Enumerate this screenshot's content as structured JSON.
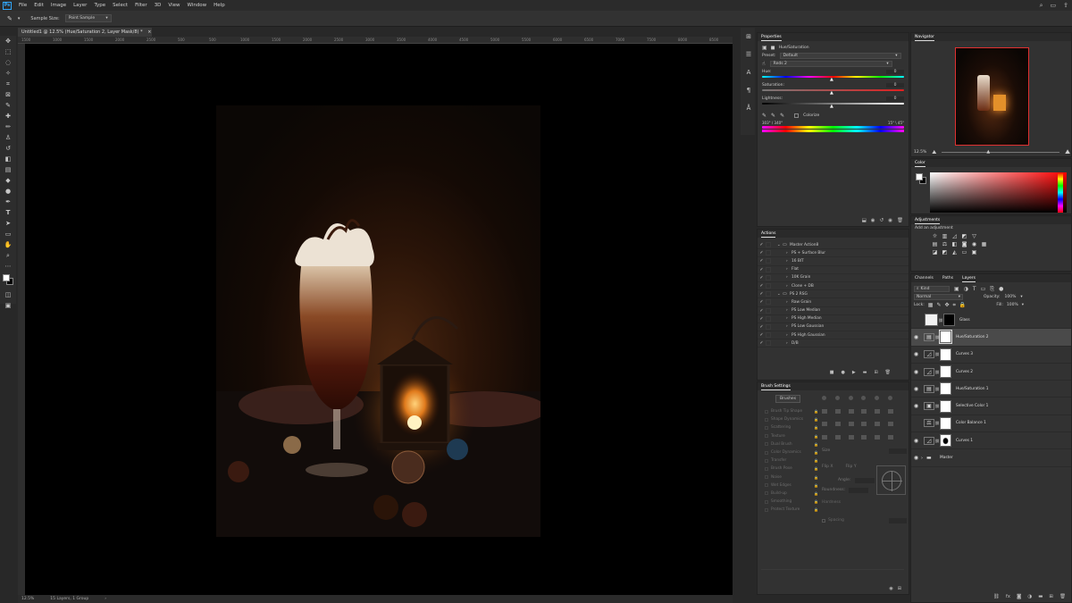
{
  "menubar": {
    "logo": "Ps",
    "items": [
      "File",
      "Edit",
      "Image",
      "Layer",
      "Type",
      "Select",
      "Filter",
      "3D",
      "View",
      "Window",
      "Help"
    ]
  },
  "options": {
    "sample_size_label": "Sample Size:",
    "sample_size_value": "Point Sample"
  },
  "document": {
    "tab_title": "Untitled1 @ 12.5% (Hue/Saturation 2, Layer Mask/8) *",
    "zoom": "12.5%",
    "status": "15 Layers, 1 Group"
  },
  "ruler": [
    "1500",
    "1000",
    "1500",
    "2000",
    "2500",
    "500",
    "500",
    "1000",
    "1500",
    "2000",
    "2500",
    "3000",
    "3500",
    "4000",
    "4500",
    "5000",
    "5500",
    "6000",
    "6500",
    "7000",
    "7500",
    "8000",
    "8500"
  ],
  "properties": {
    "title": "Properties",
    "adjustment": "Hue/Saturation",
    "preset_label": "Preset:",
    "preset_value": "Default",
    "channel_value": "Reds 2",
    "hue_label": "Hue:",
    "hue_value": "0",
    "saturation_label": "Saturation:",
    "saturation_value": "0",
    "lightness_label": "Lightness:",
    "lightness_value": "0",
    "colorize_label": "Colorize",
    "range_left": "303° / 340°",
    "range_right": "15° \\ 45°"
  },
  "navigator": {
    "title": "Navigator",
    "zoom": "12.5%"
  },
  "color": {
    "title": "Color"
  },
  "adjustments": {
    "title": "Adjustments",
    "add_label": "Add an adjustment"
  },
  "actions": {
    "title": "Actions",
    "rows": [
      {
        "label": "Master Action8",
        "level": 0,
        "expanded": true,
        "folder": true
      },
      {
        "label": "PS + Surface Blur",
        "level": 1
      },
      {
        "label": "16 BIT",
        "level": 1
      },
      {
        "label": "Flat",
        "level": 1
      },
      {
        "label": "10K Grain",
        "level": 1
      },
      {
        "label": "Clone + DB",
        "level": 1
      },
      {
        "label": "PS 2 RSG",
        "level": 0,
        "expanded": true,
        "folder": true
      },
      {
        "label": "Raw Grain",
        "level": 1
      },
      {
        "label": "PS Low Median",
        "level": 1
      },
      {
        "label": "PS High Median",
        "level": 1
      },
      {
        "label": "PS Low Gaussian",
        "level": 1
      },
      {
        "label": "PS High Gaussian",
        "level": 1
      },
      {
        "label": "D/B",
        "level": 1
      }
    ]
  },
  "brush": {
    "title": "Brush Settings",
    "brushes_btn": "Brushes",
    "items": [
      "Brush Tip Shape",
      "Shape Dynamics",
      "Scattering",
      "Texture",
      "Dual Brush",
      "Color Dynamics",
      "Transfer",
      "Brush Pose",
      "Noise",
      "Wet Edges",
      "Build-up",
      "Smoothing",
      "Protect Texture"
    ],
    "size_label": "Size",
    "flip_x": "Flip X",
    "flip_y": "Flip Y",
    "angle_label": "Angle:",
    "roundness_label": "Roundness:",
    "hardness_label": "Hardness",
    "spacing_label": "Spacing"
  },
  "layers": {
    "tabs": [
      "Channels",
      "Paths",
      "Layers"
    ],
    "kind_label": "Kind",
    "blend_mode": "Normal",
    "opacity_label": "Opacity:",
    "opacity_value": "100%",
    "lock_label": "Lock:",
    "fill_label": "Fill:",
    "fill_value": "100%",
    "rows": [
      {
        "name": "Glass",
        "visible": false,
        "type": "pixel"
      },
      {
        "name": "Hue/Saturation 2",
        "visible": true,
        "type": "hue",
        "selected": true
      },
      {
        "name": "Curves 3",
        "visible": true,
        "type": "curves"
      },
      {
        "name": "Curves 2",
        "visible": true,
        "type": "curves"
      },
      {
        "name": "Hue/Saturation 1",
        "visible": true,
        "type": "hue"
      },
      {
        "name": "Selective Color 1",
        "visible": true,
        "type": "selective"
      },
      {
        "name": "Color Balance 1",
        "visible": false,
        "type": "balance"
      },
      {
        "name": "Curves 1",
        "visible": true,
        "type": "curves"
      },
      {
        "name": "Master",
        "visible": true,
        "type": "group"
      }
    ]
  }
}
